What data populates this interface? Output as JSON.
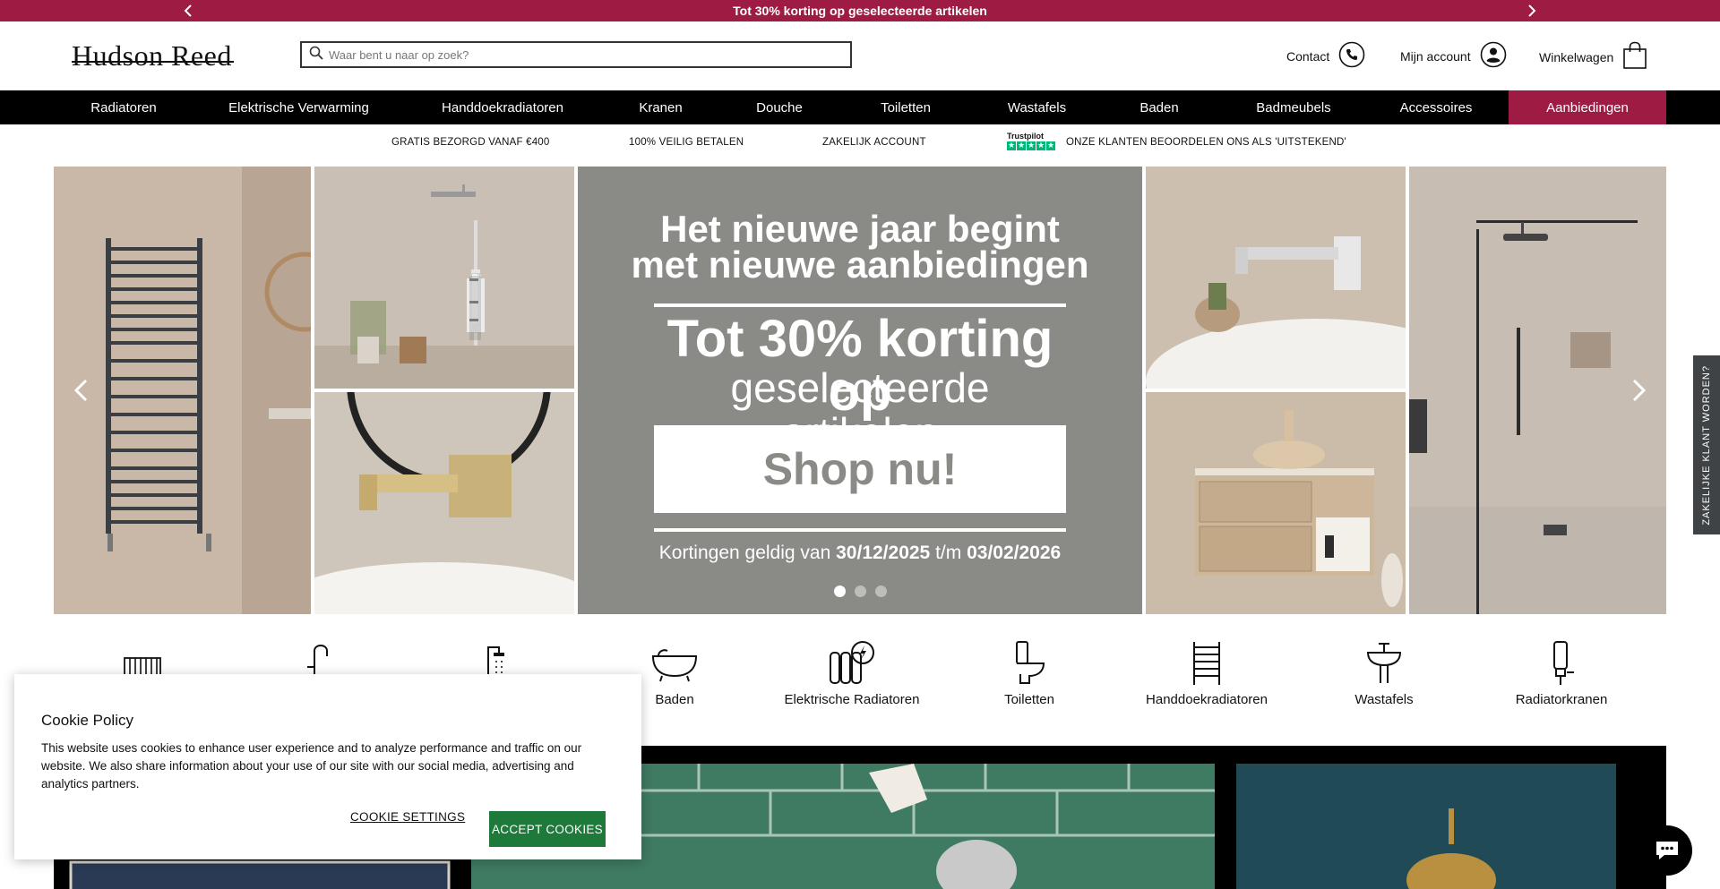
{
  "promo_bar": {
    "text": "Tot 30% korting op geselecteerde artikelen",
    "prev_icon": "chevron-left-icon",
    "next_icon": "chevron-right-icon"
  },
  "header": {
    "logo": "Hudson Reed",
    "search_placeholder": "Waar bent u naar op zoek?",
    "contact": "Contact",
    "account": "Mijn account",
    "cart": "Winkelwagen"
  },
  "nav": {
    "items": [
      "Radiatoren",
      "Elektrische Verwarming",
      "Handdoekradiatoren",
      "Kranen",
      "Douche",
      "Toiletten",
      "Wastafels",
      "Baden",
      "Badmeubels",
      "Accessoires",
      "Aanbiedingen"
    ]
  },
  "usp": {
    "items": [
      "GRATIS BEZORGD VANAF €400",
      "100% VEILIG BETALEN",
      "ZAKELIJK ACCOUNT"
    ],
    "trustpilot_label": "Trustpilot",
    "trustpilot_text": "ONZE KLANTEN BEOORDELEN ONS ALS 'UITSTEKEND'"
  },
  "hero": {
    "line1": "Het nieuwe jaar begint",
    "line2": "met nieuwe aanbiedingen",
    "headline": "Tot 30% korting op",
    "subheadline": "geselecteerde artikelen",
    "button": "Shop nu!",
    "validity_prefix": "Kortingen geldig van",
    "date_from": "30/12/2025",
    "date_sep": "t/m",
    "date_to": "03/02/2026",
    "slide_count": 3,
    "active_slide": 1
  },
  "side_tab": "ZAKELIJKE KLANT WORDEN?",
  "categories": {
    "items": [
      "",
      "",
      "",
      "Baden",
      "Elektrische Radiatoren",
      "Toiletten",
      "Handdoekradiatoren",
      "Wastafels",
      "Radiatorkranen"
    ]
  },
  "cookie": {
    "title": "Cookie Policy",
    "body": "This website uses cookies to enhance user experience and to analyze performance and traffic on our website. We also share information about your use of our site with our social media, advertising and analytics partners.",
    "settings": "COOKIE SETTINGS",
    "accept": "ACCEPT COOKIES"
  },
  "colors": {
    "brand": "#9e1c43",
    "accept": "#1e7a3a",
    "hero_bg": "#8a8a86"
  }
}
